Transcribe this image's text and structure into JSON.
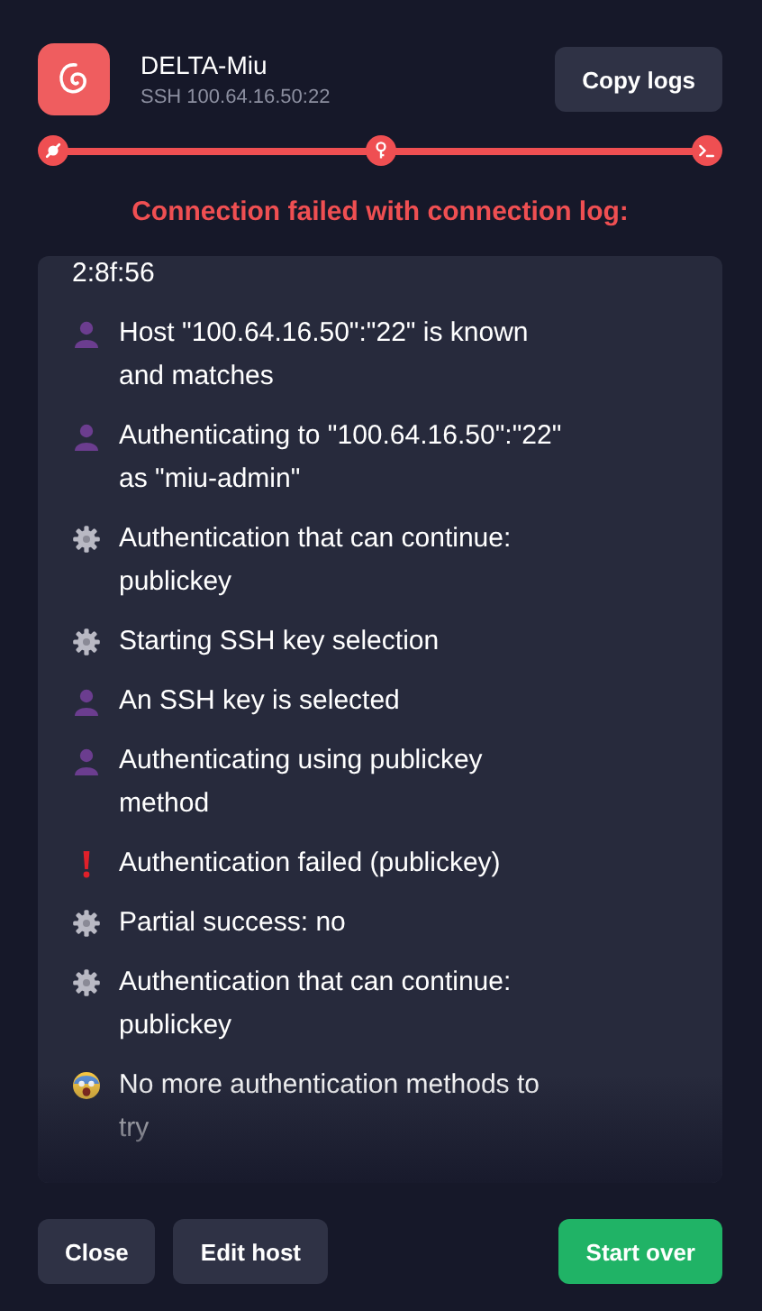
{
  "host": {
    "name": "DELTA-Miu",
    "address": "SSH 100.64.16.50:22"
  },
  "copy_button": "Copy logs",
  "progress": {
    "failed": true,
    "steps": [
      {
        "kind": "plug"
      },
      {
        "kind": "key"
      },
      {
        "kind": "terminal"
      }
    ]
  },
  "error_title": "Connection failed with connection log:",
  "log": [
    {
      "kind": "plain",
      "text": "2:8f:56"
    },
    {
      "kind": "person",
      "text": "Host \"100.64.16.50\":\"22\" is known and matches"
    },
    {
      "kind": "person",
      "text": "Authenticating to \"100.64.16.50\":\"22\" as \"miu-admin\""
    },
    {
      "kind": "gear",
      "text": "Authentication that can continue: publickey"
    },
    {
      "kind": "gear",
      "text": "Starting SSH key selection"
    },
    {
      "kind": "person",
      "text": "An SSH key is selected"
    },
    {
      "kind": "person",
      "text": "Authenticating using publickey method"
    },
    {
      "kind": "error",
      "text": "Authentication failed (publickey)"
    },
    {
      "kind": "gear",
      "text": "Partial success: no"
    },
    {
      "kind": "gear",
      "text": "Authentication that can continue: publickey"
    },
    {
      "kind": "scared",
      "text": "No more authentication methods to try"
    }
  ],
  "buttons": [
    {
      "label": "Close",
      "kind": "secondary"
    },
    {
      "label": "Edit host",
      "kind": "secondary"
    },
    {
      "label": "Start over",
      "kind": "primary"
    }
  ]
}
